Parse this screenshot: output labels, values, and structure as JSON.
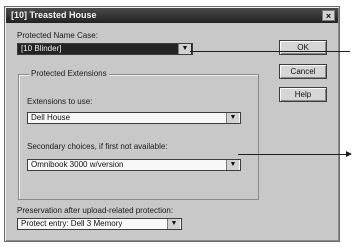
{
  "window": {
    "title": "[10] Treasted House",
    "close_label": "×"
  },
  "protected_name": {
    "label": "Protected Name Case:",
    "value": "[10 Blinder]"
  },
  "buttons": {
    "ok": "OK",
    "cancel": "Cancel",
    "help": "Help"
  },
  "protected_extensions": {
    "title": "Protected Extensions",
    "use_label": "Extensions to use:",
    "use_value": "Dell House",
    "secondary_label": "Secondary choices, if first not available:",
    "secondary_value": "Omnibook 3000 w/version"
  },
  "after_upload": {
    "label": "Preservation after upload-related protection:",
    "value": "Protect entry: Dell 3 Memory"
  },
  "icons": {
    "dropdown": "chevron-down-icon",
    "close": "close-icon",
    "pointer": "arrow-pointer-icon"
  },
  "colors": {
    "dialog_face": "#c8c8c8",
    "title_bar": "#222222",
    "selected_field": "#242424"
  }
}
